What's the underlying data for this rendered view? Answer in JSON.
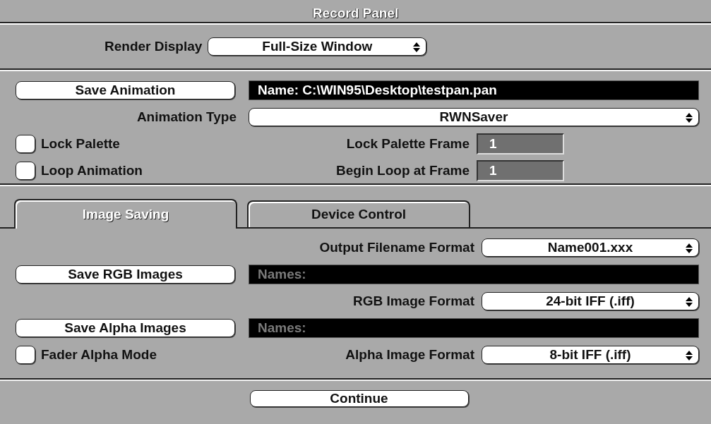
{
  "window": {
    "title": "Record Panel"
  },
  "render_display": {
    "label": "Render Display",
    "value": "Full-Size Window"
  },
  "animation": {
    "save_button": "Save Animation",
    "name_field": "Name: C:\\WIN95\\Desktop\\testpan.pan",
    "type": {
      "label": "Animation Type",
      "value": "RWNSaver"
    },
    "options": [
      {
        "label": "Lock Palette",
        "checked": false,
        "frame_label": "Lock Palette Frame",
        "frame_value": "1"
      },
      {
        "label": "Loop Animation",
        "checked": false,
        "frame_label": "Begin Loop at Frame",
        "frame_value": "1"
      }
    ]
  },
  "tabs": [
    {
      "label": "Image Saving",
      "selected": true
    },
    {
      "label": "Device Control",
      "selected": false
    }
  ],
  "image_saving": [
    {
      "kind": "select",
      "label": "Output Filename Format",
      "value": "Name001.xxx"
    },
    {
      "kind": "save",
      "button": "Save RGB Images",
      "placeholder": "Names:"
    },
    {
      "kind": "select",
      "label": "RGB Image Format",
      "value": "24-bit IFF (.iff)"
    },
    {
      "kind": "save",
      "button": "Save Alpha Images",
      "placeholder": "Names:"
    },
    {
      "kind": "checkbox_select",
      "check_label": "Fader Alpha Mode",
      "checked": false,
      "label": "Alpha Image Format",
      "value": "8-bit IFF (.iff)"
    }
  ],
  "continue_button": "Continue"
}
